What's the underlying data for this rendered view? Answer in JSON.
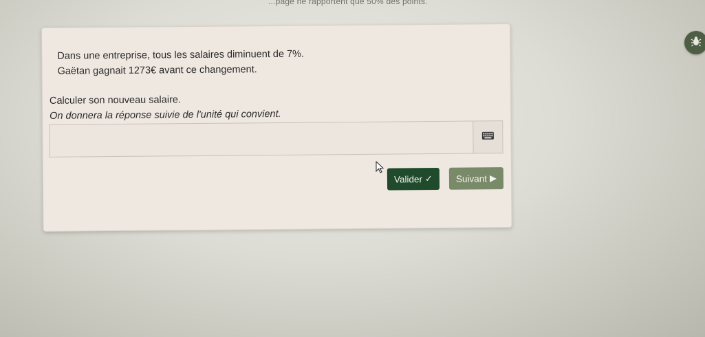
{
  "header": {
    "top_note": "...page ne rapportent que 50% des points."
  },
  "exercise": {
    "statement_line1": "Dans une entreprise, tous les salaires diminuent de 7%.",
    "statement_line2": "Gaëtan gagnait 1273€ avant ce changement.",
    "question": "Calculer son nouveau salaire.",
    "hint": "On donnera la réponse suivie de l'unité qui convient."
  },
  "answer": {
    "value": "",
    "placeholder": ""
  },
  "buttons": {
    "valider_label": "Valider",
    "valider_icon": "✓",
    "suivant_label": "Suivant",
    "suivant_icon": "▶"
  },
  "icons": {
    "keyboard": "keyboard-icon",
    "side_widget": "bug-icon"
  },
  "colors": {
    "valider_bg": "#1f4a2b",
    "suivant_bg": "#798a68",
    "card_bg": "#efe8e1"
  }
}
